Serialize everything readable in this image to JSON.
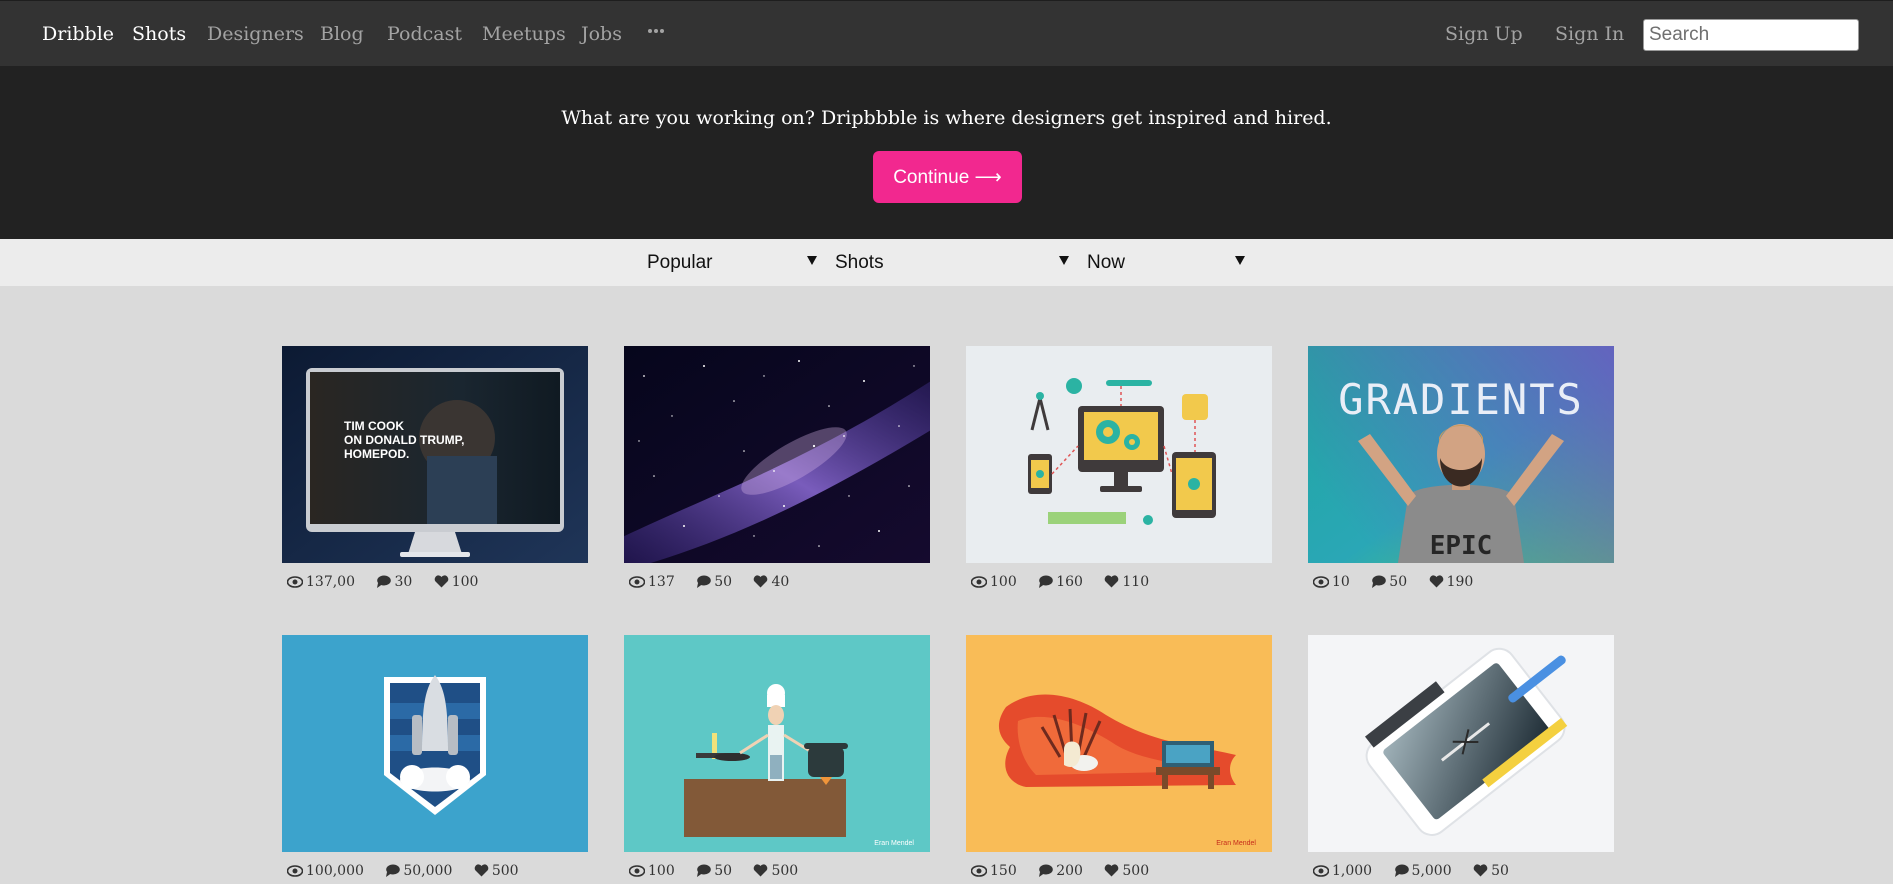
{
  "nav": {
    "brand": "Dribble",
    "links": [
      "Shots",
      "Designers",
      "Blog",
      "Podcast",
      "Meetups",
      "Jobs"
    ],
    "more_icon": "ellipsis-icon",
    "sign_up": "Sign Up",
    "sign_in": "Sign In",
    "search_placeholder": "Search"
  },
  "hero": {
    "text": "What are you working on? Dripbbble is where designers get inspired and hired.",
    "button_label": "Continue ⟶"
  },
  "filters": {
    "sort": "Popular",
    "category": "Shots",
    "timeframe": "Now"
  },
  "colors": {
    "accent": "#f2288f",
    "nav_bg": "#333333",
    "hero_bg": "#222222",
    "page_bg": "#dadada"
  },
  "shots": [
    {
      "views": "137,00",
      "comments": "30",
      "likes": "100"
    },
    {
      "views": "137",
      "comments": "50",
      "likes": "40"
    },
    {
      "views": "100",
      "comments": "160",
      "likes": "110"
    },
    {
      "views": "10",
      "comments": "50",
      "likes": "190"
    },
    {
      "views": "100,000",
      "comments": "50,000",
      "likes": "500"
    },
    {
      "views": "100",
      "comments": "50",
      "likes": "500"
    },
    {
      "views": "150",
      "comments": "200",
      "likes": "500"
    },
    {
      "views": "1,000",
      "comments": "5,000",
      "likes": "50"
    }
  ],
  "shot_art": {
    "monitor_lines": [
      "TIM COOK",
      "ON DONALD TRUMP,",
      "HOMEPOD."
    ],
    "gradients_title": "GRADIENTS",
    "shirt_text": "EPIC",
    "credit_chef": "Eran Mendel",
    "credit_throne": "Eran Mendel"
  }
}
